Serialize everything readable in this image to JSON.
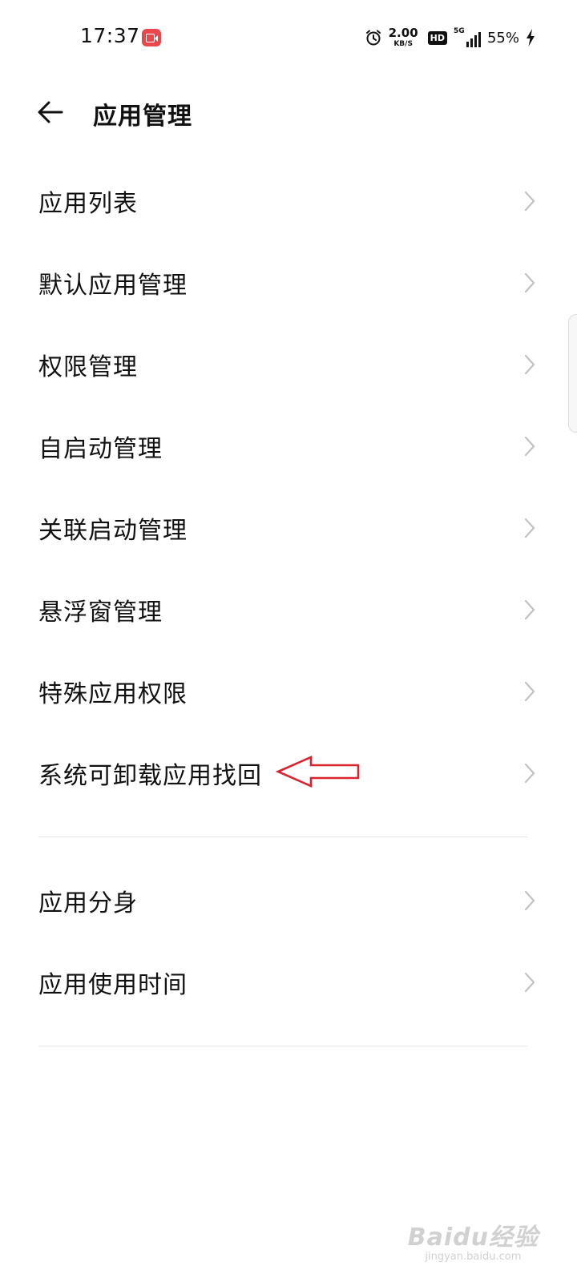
{
  "status_bar": {
    "time": "17:37",
    "net_speed_value": "2.00",
    "net_speed_unit": "KB/S",
    "hd_badge": "HD",
    "network_type": "5G",
    "battery_percent": "55%",
    "icons": [
      "screen-record-icon",
      "alarm-icon",
      "signal-icon",
      "charging-bolt-icon"
    ],
    "record_color": "#e8474c"
  },
  "header": {
    "title": "应用管理",
    "back_icon": "back-arrow-icon"
  },
  "menu": {
    "group1": [
      {
        "label": "应用列表"
      },
      {
        "label": "默认应用管理"
      },
      {
        "label": "权限管理"
      },
      {
        "label": "自启动管理"
      },
      {
        "label": "关联启动管理"
      },
      {
        "label": "悬浮窗管理"
      },
      {
        "label": "特殊应用权限"
      },
      {
        "label": "系统可卸载应用找回"
      }
    ],
    "group2": [
      {
        "label": "应用分身"
      },
      {
        "label": "应用使用时间"
      }
    ]
  },
  "annotation": {
    "arrow_color": "#d9232d",
    "points_to": "系统可卸载应用找回"
  },
  "watermark": {
    "brand": "Baidu经验",
    "sub": "jingyan.baidu.com"
  }
}
